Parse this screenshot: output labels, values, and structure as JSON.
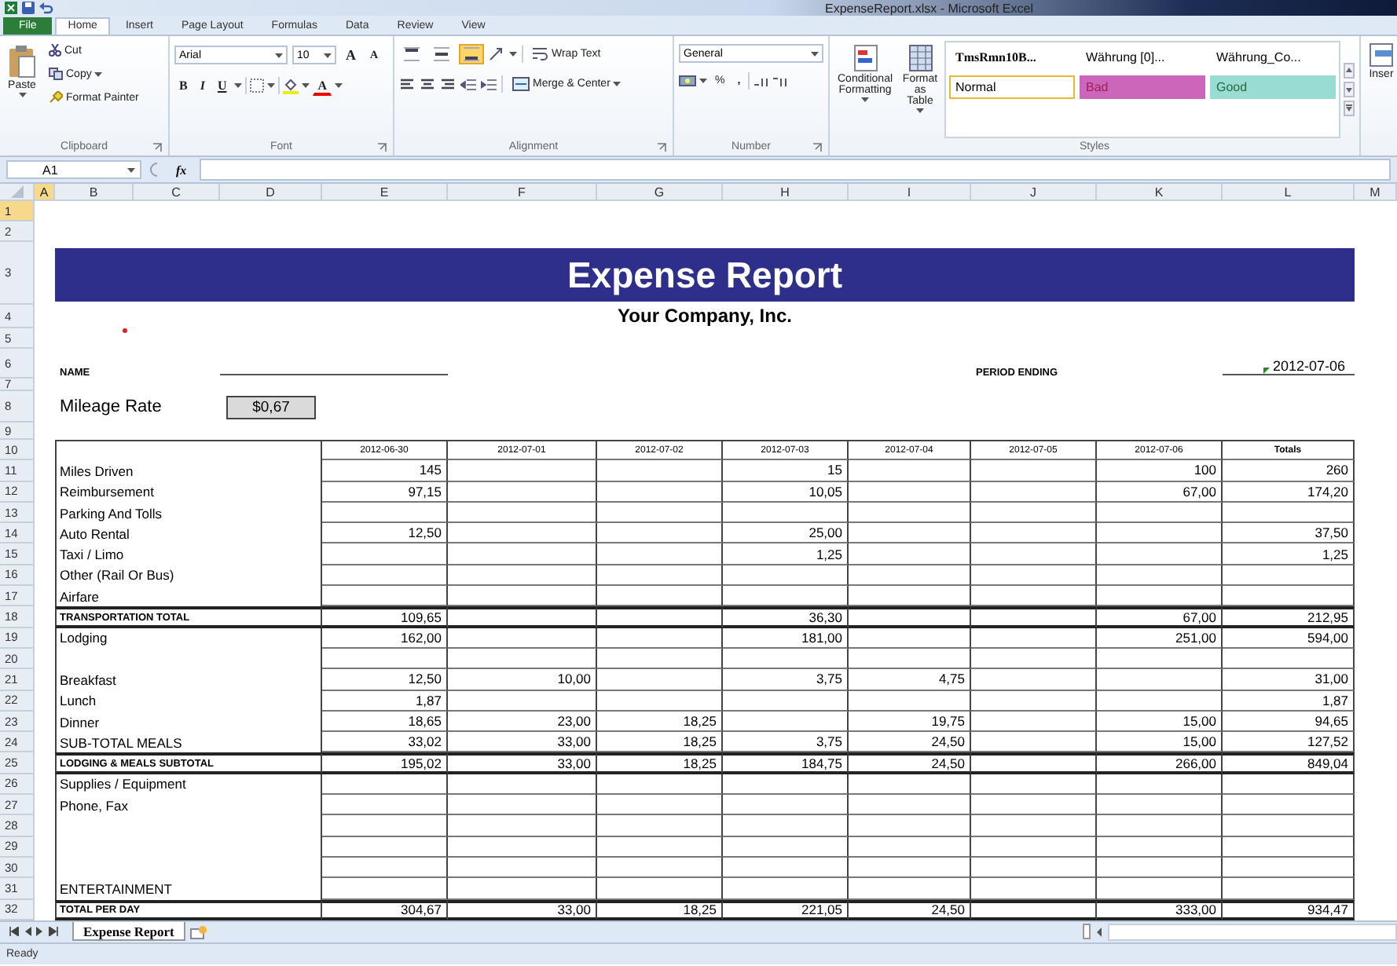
{
  "window": {
    "title": "ExpenseReport.xlsx - Microsoft Excel"
  },
  "ribbon_tabs": [
    {
      "label": "File",
      "kind": "file",
      "selected": false
    },
    {
      "label": "Home",
      "kind": "tab",
      "selected": true
    },
    {
      "label": "Insert",
      "kind": "tab",
      "selected": false
    },
    {
      "label": "Page Layout",
      "kind": "tab",
      "selected": false
    },
    {
      "label": "Formulas",
      "kind": "tab",
      "selected": false
    },
    {
      "label": "Data",
      "kind": "tab",
      "selected": false
    },
    {
      "label": "Review",
      "kind": "tab",
      "selected": false
    },
    {
      "label": "View",
      "kind": "tab",
      "selected": false
    }
  ],
  "clipboard": {
    "title": "Clipboard",
    "paste": "Paste",
    "cut": "Cut",
    "copy": "Copy",
    "format_painter": "Format Painter"
  },
  "font": {
    "title": "Font",
    "family": "Arial",
    "size": "10",
    "grow": "A",
    "shrink": "A",
    "bold": "B",
    "italic": "I",
    "underline": "U",
    "font_color": "A"
  },
  "alignment": {
    "title": "Alignment",
    "wrap_text": "Wrap Text",
    "merge_center": "Merge & Center",
    "vertical_align": [
      {
        "selected": false
      },
      {
        "selected": false
      },
      {
        "selected": true
      }
    ]
  },
  "number": {
    "title": "Number",
    "format": "General",
    "percent": "%",
    "comma": ","
  },
  "styles": {
    "title": "Styles",
    "conditional_formatting": "Conditional Formatting",
    "format_as_table": "Format as Table",
    "gallery": [
      {
        "label": "TmsRmn10B...",
        "kind": "bold",
        "color": "#ffffff",
        "selected": false
      },
      {
        "label": "Währung [0]...",
        "kind": "plain",
        "color": "#ffffff",
        "selected": false
      },
      {
        "label": "Währung_Co...",
        "kind": "plain",
        "color": "#ffffff",
        "selected": false
      },
      {
        "label": "Normal",
        "kind": "plain",
        "color": "#ffffff",
        "selected": true
      },
      {
        "label": "Bad",
        "kind": "bad",
        "color": "#cc66bb",
        "selected": false
      },
      {
        "label": "Good",
        "kind": "good",
        "color": "#99dcd4",
        "selected": false
      }
    ]
  },
  "cells": {
    "insert": "Inser"
  },
  "formula_bar": {
    "name_box": "A1",
    "function_button": "fx"
  },
  "column_headers": [
    {
      "label": "A",
      "selected": true
    },
    {
      "label": "B",
      "selected": false
    },
    {
      "label": "C",
      "selected": false
    },
    {
      "label": "D",
      "selected": false
    },
    {
      "label": "E",
      "selected": false
    },
    {
      "label": "F",
      "selected": false
    },
    {
      "label": "G",
      "selected": false
    },
    {
      "label": "H",
      "selected": false
    },
    {
      "label": "I",
      "selected": false
    },
    {
      "label": "J",
      "selected": false
    },
    {
      "label": "K",
      "selected": false
    },
    {
      "label": "L",
      "selected": false
    },
    {
      "label": "M",
      "selected": false
    }
  ],
  "row_headers": [
    {
      "label": "1",
      "selected": true
    },
    {
      "label": "2",
      "selected": false
    },
    {
      "label": "3",
      "selected": false
    },
    {
      "label": "4",
      "selected": false
    },
    {
      "label": "5",
      "selected": false
    },
    {
      "label": "6",
      "selected": false
    },
    {
      "label": "7",
      "selected": false
    },
    {
      "label": "8",
      "selected": false
    },
    {
      "label": "9",
      "selected": false
    },
    {
      "label": "10",
      "selected": false
    },
    {
      "label": "11",
      "selected": false
    },
    {
      "label": "12",
      "selected": false
    },
    {
      "label": "13",
      "selected": false
    },
    {
      "label": "14",
      "selected": false
    },
    {
      "label": "15",
      "selected": false
    },
    {
      "label": "16",
      "selected": false
    },
    {
      "label": "17",
      "selected": false
    },
    {
      "label": "18",
      "selected": false
    },
    {
      "label": "19",
      "selected": false
    },
    {
      "label": "20",
      "selected": false
    },
    {
      "label": "21",
      "selected": false
    },
    {
      "label": "22",
      "selected": false
    },
    {
      "label": "23",
      "selected": false
    },
    {
      "label": "24",
      "selected": false
    },
    {
      "label": "25",
      "selected": false
    },
    {
      "label": "26",
      "selected": false
    },
    {
      "label": "27",
      "selected": false
    },
    {
      "label": "28",
      "selected": false
    },
    {
      "label": "29",
      "selected": false
    },
    {
      "label": "30",
      "selected": false
    },
    {
      "label": "31",
      "selected": false
    },
    {
      "label": "32",
      "selected": false
    }
  ],
  "report": {
    "title": "Expense Report",
    "company": "Your Company, Inc.",
    "name_label": "NAME",
    "period_label": "PERIOD ENDING",
    "period_value": "2012-07-06",
    "mileage_label": "Mileage Rate",
    "mileage_value": "$0,67",
    "columns": [
      "2012-06-30",
      "2012-07-01",
      "2012-07-02",
      "2012-07-03",
      "2012-07-04",
      "2012-07-05",
      "2012-07-06",
      "Totals"
    ],
    "rows": [
      {
        "kind": "item",
        "label": "Miles Driven",
        "E": "145",
        "H": "15",
        "K": "100",
        "L": "260"
      },
      {
        "kind": "item",
        "label": "Reimbursement",
        "E": "97,15",
        "H": "10,05",
        "K": "67,00",
        "L": "174,20"
      },
      {
        "kind": "item",
        "label": "Parking And Tolls"
      },
      {
        "kind": "item",
        "label": "Auto Rental",
        "E": "12,50",
        "H": "25,00",
        "L": "37,50"
      },
      {
        "kind": "item",
        "label": "Taxi / Limo",
        "H": "1,25",
        "L": "1,25"
      },
      {
        "kind": "item",
        "label": "Other (Rail Or Bus)"
      },
      {
        "kind": "item",
        "label": "Airfare"
      },
      {
        "kind": "total",
        "label": "TRANSPORTATION TOTAL",
        "E": "109,65",
        "H": "36,30",
        "K": "67,00",
        "L": "212,95"
      },
      {
        "kind": "item",
        "label": "Lodging",
        "E": "162,00",
        "H": "181,00",
        "K": "251,00",
        "L": "594,00"
      },
      {
        "kind": "item"
      },
      {
        "kind": "item",
        "label": "Breakfast",
        "E": "12,50",
        "F": "10,00",
        "H": "3,75",
        "I": "4,75",
        "L": "31,00"
      },
      {
        "kind": "item",
        "label": "Lunch",
        "E": "1,87",
        "L": "1,87"
      },
      {
        "kind": "item",
        "label": "Dinner",
        "E": "18,65",
        "F": "23,00",
        "G": "18,25",
        "I": "19,75",
        "K": "15,00",
        "L": "94,65"
      },
      {
        "kind": "item",
        "label": "SUB-TOTAL MEALS",
        "E": "33,02",
        "F": "33,00",
        "G": "18,25",
        "H": "3,75",
        "I": "24,50",
        "K": "15,00",
        "L": "127,52"
      },
      {
        "kind": "total",
        "label": "LODGING & MEALS SUBTOTAL",
        "E": "195,02",
        "F": "33,00",
        "G": "18,25",
        "H": "184,75",
        "I": "24,50",
        "K": "266,00",
        "L": "849,04"
      },
      {
        "kind": "item",
        "label": "Supplies / Equipment"
      },
      {
        "kind": "item",
        "label": "Phone, Fax"
      },
      {
        "kind": "item"
      },
      {
        "kind": "item"
      },
      {
        "kind": "item"
      },
      {
        "kind": "item",
        "label": "ENTERTAINMENT"
      },
      {
        "kind": "total",
        "label": "TOTAL PER DAY",
        "E": "304,67",
        "F": "33,00",
        "G": "18,25",
        "H": "221,05",
        "I": "24,50",
        "K": "333,00",
        "L": "934,47"
      }
    ]
  },
  "sheet_tabs": [
    {
      "label": "Expense Report",
      "selected": true
    }
  ],
  "status_bar": {
    "text": "Ready"
  }
}
